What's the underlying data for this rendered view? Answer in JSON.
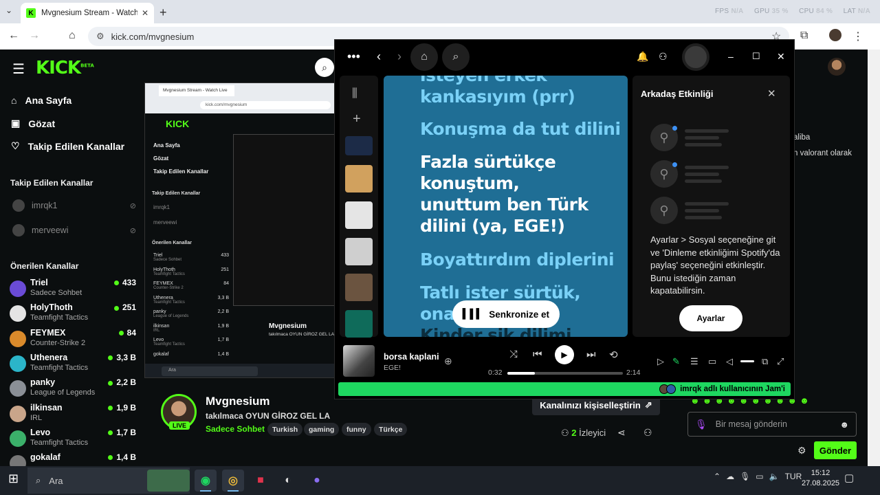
{
  "browser": {
    "tab_title": "Mvgnesium Stream - Watch Liv",
    "url": "kick.com/mvgnesium",
    "perf": {
      "fps_label": "FPS",
      "fps": "N/A",
      "gpu_label": "GPU",
      "gpu": "35 %",
      "cpu_label": "CPU",
      "cpu": "84 %",
      "lat_label": "LAT",
      "lat": "N/A"
    }
  },
  "kick": {
    "logo": "KICK",
    "logo_badge": "BETA",
    "nav": [
      {
        "label": "Ana Sayfa",
        "icon": "home-icon"
      },
      {
        "label": "Gözat",
        "icon": "browse-icon"
      },
      {
        "label": "Takip Edilen Kanallar",
        "icon": "heart-icon"
      }
    ],
    "followed_title": "Takip Edilen Kanallar",
    "followed": [
      "imrqk1",
      "merveewi"
    ],
    "recommended_title": "Önerilen Kanallar",
    "recommended": [
      {
        "name": "Triel",
        "category": "Sadece Sohbet",
        "viewers": "433",
        "color": "#6a4bd6"
      },
      {
        "name": "HolyThoth",
        "category": "Teamfight Tactics",
        "viewers": "251",
        "color": "#e4e4e4"
      },
      {
        "name": "FEYMEX",
        "category": "Counter-Strike 2",
        "viewers": "84",
        "color": "#d98a2b"
      },
      {
        "name": "Uthenera",
        "category": "Teamfight Tactics",
        "viewers": "3,3 B",
        "color": "#2bb5c9"
      },
      {
        "name": "panky",
        "category": "League of Legends",
        "viewers": "2,2 B",
        "color": "#8a8f96"
      },
      {
        "name": "ilkinsan",
        "category": "IRL",
        "viewers": "1,9 B",
        "color": "#c9a58a"
      },
      {
        "name": "Levo",
        "category": "Teamfight Tactics",
        "viewers": "1,7 B",
        "color": "#3bb06a"
      },
      {
        "name": "gokalaf",
        "category": "",
        "viewers": "1,4 B",
        "color": "#777"
      }
    ],
    "stream": {
      "streamer": "Mvgnesium",
      "live": "LIVE",
      "title": "takılmaca OYUN GİROZ GEL LA",
      "category": "Sadece Sohbet",
      "tags": [
        "Turkish",
        "gaming",
        "funny",
        "Türkçe"
      ],
      "customize": "Kanalınızı kişiselleştirin",
      "viewers": "2",
      "viewers_label": "İzleyici"
    },
    "chat": {
      "partial1": "aliba",
      "partial2": "n valorant olarak",
      "placeholder": "Bir mesaj gönderin",
      "send": "Gönder"
    }
  },
  "nested": {
    "tab": "Mvgnesium Stream - Watch Live",
    "url": "kick.com/mvgnesium",
    "logo": "KICK",
    "nav": [
      "Ana Sayfa",
      "Gözat",
      "Takip Edilen Kanallar"
    ],
    "followed_title": "Takip Edilen Kanallar",
    "followed": [
      "imrqk1",
      "merveewi"
    ],
    "rec_title": "Önerilen Kanallar",
    "rec": [
      {
        "name": "Triel",
        "cat": "Sadece Sohbet",
        "v": "433"
      },
      {
        "name": "HolyThoth",
        "cat": "Teamfight Tactics",
        "v": "251"
      },
      {
        "name": "FEYMEX",
        "cat": "Counter-Strike 2",
        "v": "84"
      },
      {
        "name": "Uthenera",
        "cat": "Teamfight Tactics",
        "v": "3,3 B"
      },
      {
        "name": "panky",
        "cat": "League of Legends",
        "v": "2,2 B"
      },
      {
        "name": "ilkinsan",
        "cat": "IRL",
        "v": "1,9 B"
      },
      {
        "name": "Levo",
        "cat": "Teamfight Tactics",
        "v": "1,7 B"
      },
      {
        "name": "gokalaf",
        "cat": "",
        "v": "1,4 B"
      }
    ],
    "streamer": "Mvgnesium",
    "sub": "takılmaca OYUN GİROZ GEL LA",
    "search": "Ara"
  },
  "spotify": {
    "lyrics": [
      {
        "text": "isteyen erkek",
        "state": "dim"
      },
      {
        "text": "kankasıyım (prr)",
        "state": "dim"
      },
      {
        "text": "Konuşma da tut dilini",
        "state": "dim"
      },
      {
        "text": "Fazla sürtükçe",
        "state": "cur"
      },
      {
        "text": "konuştum,",
        "state": "cur"
      },
      {
        "text": "unuttum ben Türk",
        "state": "cur"
      },
      {
        "text": "dilini (ya, EGE!)",
        "state": "cur"
      },
      {
        "text": "Boyattırdım diplerini",
        "state": "dim"
      },
      {
        "text": "Tatlı ister sürtük,",
        "state": "dim"
      },
      {
        "text": "ona",
        "state": "dim"
      },
      {
        "text": "Kinder sik dilimi",
        "state": "dark"
      }
    ],
    "sync_label": "Senkronize et",
    "friends": {
      "title": "Arkadaş Etkinliği",
      "message": "Ayarlar > Sosyal seçeneğine git ve 'Dinleme etkinliğimi Spotify'da paylaş' seçeneğini etkinleştir. Bunu istediğin zaman kapatabilirsin.",
      "button": "Ayarlar"
    },
    "now_playing": {
      "title": "borsa kaplani",
      "artist": "EGE!",
      "current": "0:32",
      "total": "2:14",
      "progress": 0.24
    },
    "jam": "imrqk adlı kullanıcının Jam'i"
  },
  "taskbar": {
    "search": "Ara",
    "lang": "TUR",
    "time": "15:12",
    "date": "27.08.2025"
  }
}
